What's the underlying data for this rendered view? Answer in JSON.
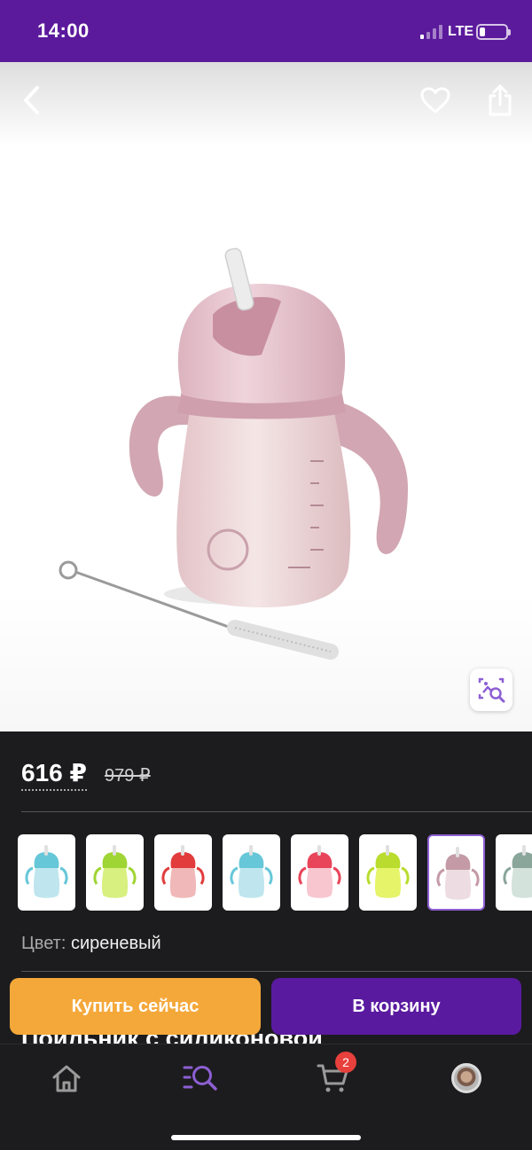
{
  "status_bar": {
    "time": "14:00",
    "network": "LTE",
    "signal_bars_on": 1,
    "signal_bars_total": 4,
    "battery_level": 0.2,
    "background": "#5b1a9c"
  },
  "header": {
    "back_icon": "chevron-left-icon",
    "favorite_icon": "heart-icon",
    "share_icon": "share-icon"
  },
  "hero": {
    "product_color": "#e9c9d2",
    "image_search_icon": "image-search-icon"
  },
  "price": {
    "current": "616 ₽",
    "old": "979 ₽"
  },
  "variants": [
    {
      "cap": "#66c7d8",
      "body": "#bfe6ee",
      "active": false
    },
    {
      "cap": "#9fd534",
      "body": "#d8f07f",
      "active": false
    },
    {
      "cap": "#e23c3c",
      "body": "#f0b8b8",
      "active": false
    },
    {
      "cap": "#66c7d8",
      "body": "#bfe6ee",
      "active": false
    },
    {
      "cap": "#e8455a",
      "body": "#f7c6cf",
      "active": false
    },
    {
      "cap": "#b9dc2e",
      "body": "#e6f46a",
      "active": false
    },
    {
      "cap": "#c49aa6",
      "body": "#eddde2",
      "active": true
    },
    {
      "cap": "#8aa69a",
      "body": "#d4e2dc",
      "active": false
    }
  ],
  "color": {
    "label": "Цвет:",
    "value": "сиреневый"
  },
  "product_title": "Поильник с силиконовой",
  "actions": {
    "buy_now": "Купить сейчас",
    "add_to_cart": "В корзину"
  },
  "tab_bar": {
    "home_icon": "home-icon",
    "catalog_icon": "search-list-icon",
    "cart_icon": "cart-icon",
    "cart_count": "2",
    "profile_icon": "avatar",
    "accent": "#8d5fd3"
  }
}
